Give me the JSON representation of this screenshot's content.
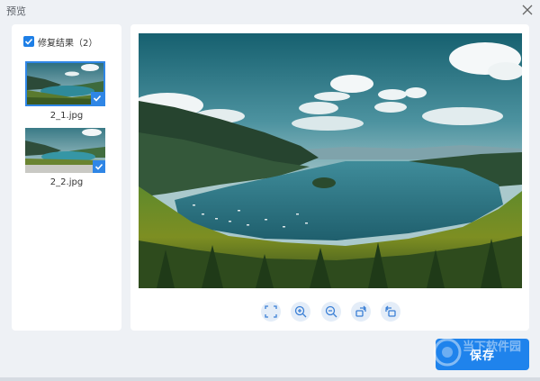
{
  "window": {
    "title": "预览"
  },
  "results": {
    "label": "修复结果（2）",
    "checked": true,
    "items": [
      {
        "filename": "2_1.jpg",
        "selected": true
      },
      {
        "filename": "2_2.jpg",
        "selected": false
      }
    ]
  },
  "toolbar": {
    "tools": [
      {
        "icon": "fit-screen-icon"
      },
      {
        "icon": "zoom-in-icon"
      },
      {
        "icon": "zoom-out-icon"
      },
      {
        "icon": "rotate-right-icon"
      },
      {
        "icon": "rotate-left-icon"
      }
    ]
  },
  "actions": {
    "save_label": "保存"
  },
  "watermark": {
    "text": "当下软件园"
  },
  "colors": {
    "accent": "#1e7fe6",
    "panel": "#ffffff",
    "background": "#eef1f5"
  }
}
